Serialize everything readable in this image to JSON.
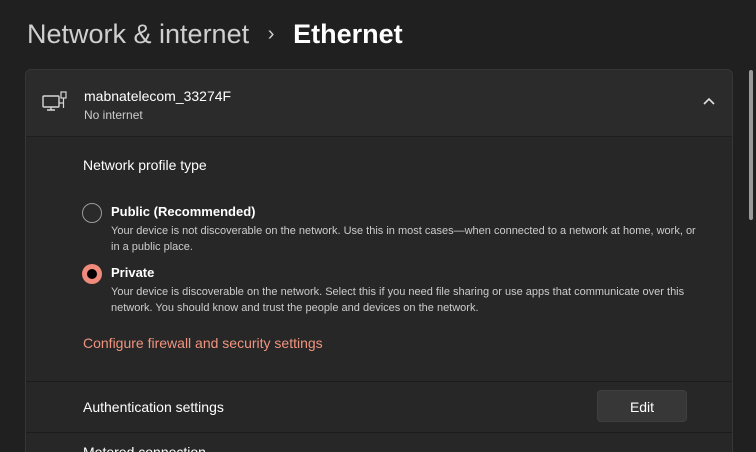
{
  "breadcrumb": {
    "parent": "Network & internet",
    "separator": "›",
    "current": "Ethernet"
  },
  "network": {
    "name": "mabnatelecom_33274F",
    "status": "No internet",
    "icon": "ethernet-monitor-icon",
    "expand_icon": "chevron-up-icon"
  },
  "profile": {
    "title": "Network profile type",
    "options": [
      {
        "label": "Public (Recommended)",
        "description": "Your device is not discoverable on the network. Use this in most cases—when connected to a network at home, work, or in a public place.",
        "selected": false
      },
      {
        "label": "Private",
        "description": "Your device is discoverable on the network. Select this if you need file sharing or use apps that communicate over this network. You should know and trust the people and devices on the network.",
        "selected": true
      }
    ],
    "firewall_link": "Configure firewall and security settings"
  },
  "auth": {
    "label": "Authentication settings",
    "button": "Edit"
  },
  "metered": {
    "label": "Metered connection"
  },
  "colors": {
    "accent": "#f08a7a",
    "link": "#f0947f",
    "background": "#202020",
    "card": "#2c2c2c"
  }
}
